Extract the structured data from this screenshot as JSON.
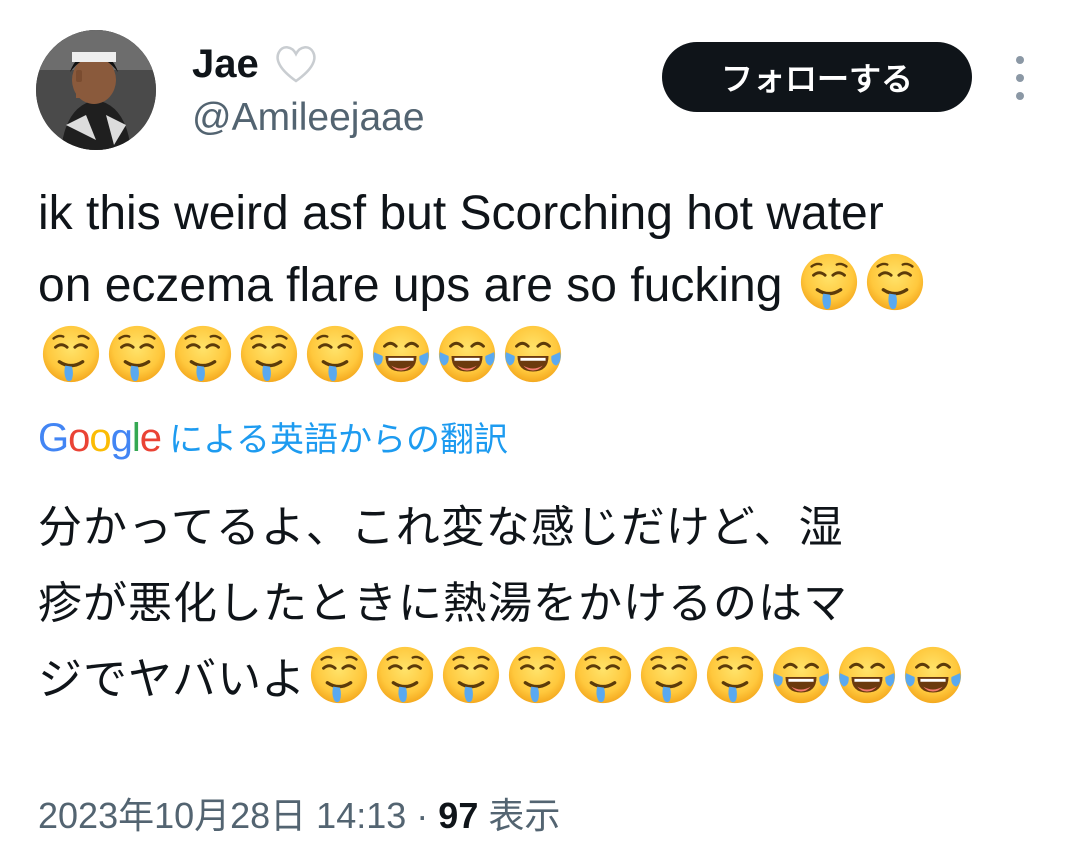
{
  "user": {
    "display_name": "Jae",
    "handle": "@Amileejaae",
    "badge_icon": "white-heart-icon"
  },
  "actions": {
    "follow_label": "フォローする",
    "more_icon": "more-vertical-icon"
  },
  "tweet": {
    "text_line_1": "ik this weird asf but Scorching hot water",
    "text_line_2": "on eczema flare ups are so fucking",
    "emojis_line_2": [
      "drooling-face",
      "drooling-face"
    ],
    "emojis_line_3": [
      "drooling-face",
      "drooling-face",
      "drooling-face",
      "drooling-face",
      "drooling-face",
      "tears-of-joy-face",
      "tears-of-joy-face",
      "tears-of-joy-face"
    ]
  },
  "translation": {
    "provider": "Google",
    "label": "による英語からの翻訳",
    "text_line_1": "分かってるよ、これ変な感じだけど、湿",
    "text_line_2": "疹が悪化したときに熱湯をかけるのはマ",
    "text_line_3": "ジでヤバいよ",
    "emojis_line_3": [
      "drooling-face",
      "drooling-face",
      "drooling-face",
      "drooling-face",
      "drooling-face",
      "drooling-face",
      "drooling-face",
      "tears-of-joy-face",
      "tears-of-joy-face",
      "tears-of-joy-face"
    ]
  },
  "meta": {
    "timestamp": "2023年10月28日 14:13",
    "separator": "·",
    "views_count": "97",
    "views_label": "表示"
  },
  "colors": {
    "text_primary": "#0f1419",
    "text_secondary": "#536471",
    "link_blue": "#1d9bf0",
    "follow_bg": "#0f1419"
  }
}
